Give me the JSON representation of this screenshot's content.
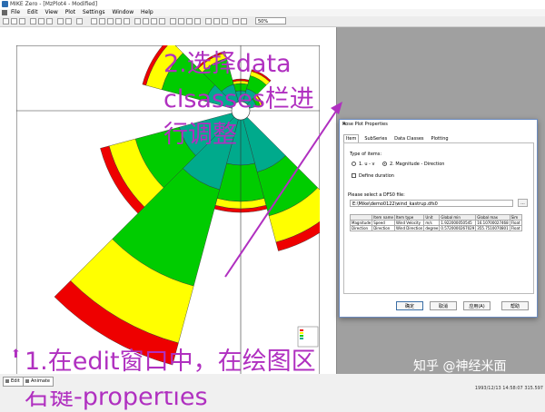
{
  "window": {
    "title": "MIKE Zero - [MzPlot4 - Modified]"
  },
  "menu": {
    "items": [
      "File",
      "Edit",
      "View",
      "Plot",
      "Settings",
      "Window",
      "Help"
    ]
  },
  "toolbar": {
    "zoom": "50%"
  },
  "annotations": {
    "step2": "2.选择data clsasses栏进行调整",
    "step1": "1.在edit窗口中，在绘图区右键-properties"
  },
  "dialog": {
    "title": "Rose Plot Properties",
    "close": "✕",
    "tabs": [
      "Item",
      "SubSeries",
      "Data Classes",
      "Plotting"
    ],
    "type_label": "Type of items:",
    "option1": "1. u - v",
    "option2": "2. Magnitude - Direction",
    "define_duration": "Define duration",
    "dfs0_label": "Please select a DFS0 file:",
    "dfs0_path": "E:\\Mike\\demo0122\\wind_kastrup.dfs0",
    "browse": "...",
    "table": {
      "headers": [
        "",
        "Item name",
        "Item type",
        "Unit",
        "Global min",
        "Global max",
        "Sim"
      ],
      "rows": [
        [
          "Magnitude",
          "Speed",
          "Wind Velocity",
          "m/s",
          "1.922000050545",
          "16.10700027468",
          "Float"
        ],
        [
          "Direction",
          "Direction",
          "Wind Direction",
          "degree",
          "0.5720000267029",
          "355.7510070801",
          "Float"
        ]
      ]
    },
    "buttons": {
      "ok": "确定",
      "cancel": "取消",
      "apply": "应用(A)",
      "help": "帮助"
    }
  },
  "doc_tabs": [
    "Edit",
    "Animate"
  ],
  "status": "1993/12/13 14:58:07  315.597",
  "watermark": "知乎 @神经米面",
  "colors": {
    "accent": "#b030c0",
    "band1": "#00aa8c",
    "band2": "#00cc00",
    "band3": "#ffff00",
    "band4": "#ee0000"
  },
  "icons": [
    "app-icon",
    "close-icon",
    "arrow-up-icon"
  ]
}
